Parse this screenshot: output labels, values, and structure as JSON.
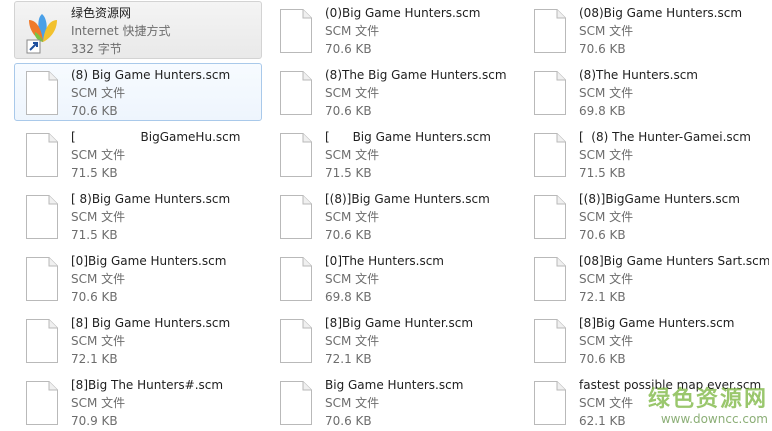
{
  "shortcut": {
    "name": "绿色资源网",
    "type": "Internet 快捷方式",
    "size": "332 字节"
  },
  "files": [
    {
      "name": "(0)Big Game Hunters.scm",
      "type": "SCM 文件",
      "size": "70.6 KB"
    },
    {
      "name": "(08)Big Game Hunters.scm",
      "type": "SCM 文件",
      "size": "70.6 KB"
    },
    {
      "name": "(8) Big Game Hunters.scm",
      "type": "SCM 文件",
      "size": "70.6 KB"
    },
    {
      "name": "(8)The Big Game Hunters.scm",
      "type": "SCM 文件",
      "size": "70.6 KB"
    },
    {
      "name": "(8)The Hunters.scm",
      "type": "SCM 文件",
      "size": "69.8 KB"
    },
    {
      "name": "[                 BigGameHu.scm",
      "type": "SCM 文件",
      "size": "71.5 KB"
    },
    {
      "name": "[      Big Game Hunters.scm",
      "type": "SCM 文件",
      "size": "71.5 KB"
    },
    {
      "name": "[  (8) The Hunter-Gamei.scm",
      "type": "SCM 文件",
      "size": "71.5 KB"
    },
    {
      "name": "[ 8)Big Game Hunters.scm",
      "type": "SCM 文件",
      "size": "71.5 KB"
    },
    {
      "name": "[(8)]Big Game Hunters.scm",
      "type": "SCM 文件",
      "size": "70.6 KB"
    },
    {
      "name": "[(8)]BigGame Hunters.scm",
      "type": "SCM 文件",
      "size": "70.6 KB"
    },
    {
      "name": "[0]Big Game Hunters.scm",
      "type": "SCM 文件",
      "size": "70.6 KB"
    },
    {
      "name": "[0]The Hunters.scm",
      "type": "SCM 文件",
      "size": "69.8 KB"
    },
    {
      "name": "[08]Big Game Hunters Sart.scm",
      "type": "SCM 文件",
      "size": "72.1 KB"
    },
    {
      "name": "[8] Big Game Hunters.scm",
      "type": "SCM 文件",
      "size": "72.1 KB"
    },
    {
      "name": "[8]Big Game Hunter.scm",
      "type": "SCM 文件",
      "size": "72.1 KB"
    },
    {
      "name": "[8]Big Game Hunters.scm",
      "type": "SCM 文件",
      "size": "70.6 KB"
    },
    {
      "name": "[8]Big The Hunters#.scm",
      "type": "SCM 文件",
      "size": "70.9 KB"
    },
    {
      "name": "Big Game Hunters.scm",
      "type": "SCM 文件",
      "size": "70.6 KB"
    },
    {
      "name": "fastest possible map ever.scm",
      "type": "SCM 文件",
      "size": "62.1 KB"
    }
  ],
  "watermark": {
    "title": "绿色资源网",
    "url": "www.downcc.com"
  }
}
